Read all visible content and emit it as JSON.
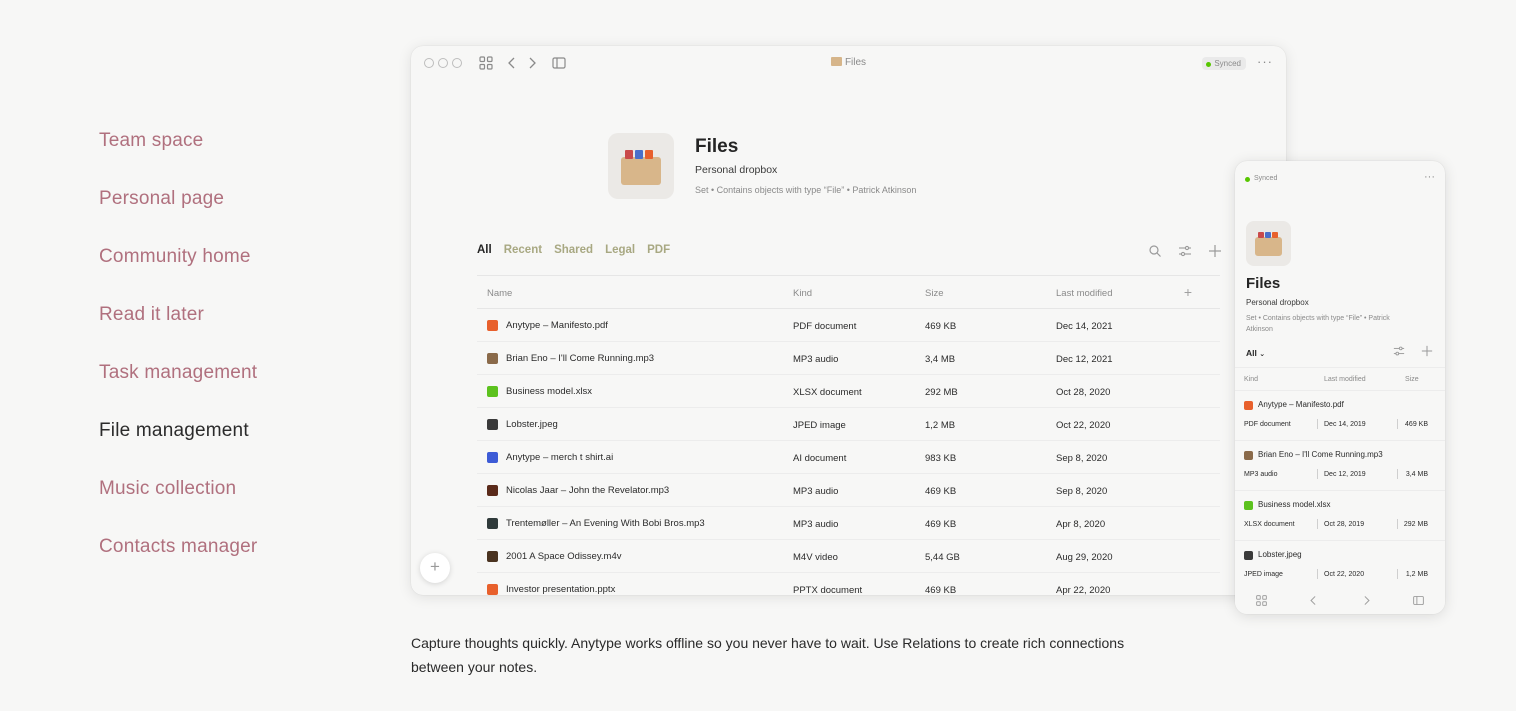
{
  "side_menu": {
    "items": [
      {
        "label": "Team space"
      },
      {
        "label": "Personal page"
      },
      {
        "label": "Community home"
      },
      {
        "label": "Read it later"
      },
      {
        "label": "Task management"
      },
      {
        "label": "File management",
        "active": true
      },
      {
        "label": "Music collection"
      },
      {
        "label": "Contacts manager"
      }
    ]
  },
  "desktop": {
    "window_title": "Files",
    "sync_status": "Synced",
    "set": {
      "title": "Files",
      "description": "Personal dropbox",
      "meta": "Set  •  Contains objects with type “File”  •  Patrick Atkinson"
    },
    "views": [
      "All",
      "Recent",
      "Shared",
      "Legal",
      "PDF"
    ],
    "columns": [
      "Name",
      "Kind",
      "Size",
      "Last modified"
    ],
    "rows": [
      {
        "name": "Anytype – Manifesto.pdf",
        "kind": "PDF document",
        "size": "469 KB",
        "modified": "Dec 14, 2021",
        "icon_color": "#e8602c"
      },
      {
        "name": "Brian Eno – I'll Come Running.mp3",
        "kind": "MP3 audio",
        "size": "3,4 MB",
        "modified": "Dec 12, 2021",
        "icon_color": "#8a6a4a"
      },
      {
        "name": "Business model.xlsx",
        "kind": "XLSX document",
        "size": "292 MB",
        "modified": "Oct 28, 2020",
        "icon_color": "#5cc21e"
      },
      {
        "name": "Lobster.jpeg",
        "kind": "JPED image",
        "size": "1,2 MB",
        "modified": "Oct 22, 2020",
        "icon_color": "#3a3a3a"
      },
      {
        "name": "Anytype – merch t shirt.ai",
        "kind": "AI document",
        "size": "983 KB",
        "modified": "Sep 8, 2020",
        "icon_color": "#3d5bd6"
      },
      {
        "name": "Nicolas Jaar – John the Revelator.mp3",
        "kind": "MP3 audio",
        "size": "469 KB",
        "modified": "Sep 8, 2020",
        "icon_color": "#5a2a1a"
      },
      {
        "name": "Trentemøller – An Evening With Bobi Bros.mp3",
        "kind": "MP3 audio",
        "size": "469 KB",
        "modified": "Apr 8, 2020",
        "icon_color": "#2f3a3a"
      },
      {
        "name": "2001 A Space Odissey.m4v",
        "kind": "M4V video",
        "size": "5,44 GB",
        "modified": "Aug 29, 2020",
        "icon_color": "#4a3320"
      },
      {
        "name": "Investor presentation.pptx",
        "kind": "PPTX document",
        "size": "469 KB",
        "modified": "Apr 22, 2020",
        "icon_color": "#e8602c"
      }
    ]
  },
  "mobile": {
    "sync_status": "Synced",
    "set": {
      "title": "Files",
      "description": "Personal dropbox",
      "meta": "Set  •  Contains objects with type “File”  •  Patrick Atkinson"
    },
    "view": "All",
    "columns": [
      "Kind",
      "Last modified",
      "Size"
    ],
    "rows": [
      {
        "name": "Anytype – Manifesto.pdf",
        "kind": "PDF document",
        "modified": "Dec 14, 2019",
        "size": "469 KB",
        "icon_color": "#e8602c"
      },
      {
        "name": "Brian Eno – I'll Come Running.mp3",
        "kind": "MP3 audio",
        "modified": "Dec 12, 2019",
        "size": "3,4 MB",
        "icon_color": "#8a6a4a"
      },
      {
        "name": "Business model.xlsx",
        "kind": "XLSX document",
        "modified": "Oct 28, 2019",
        "size": "292 MB",
        "icon_color": "#5cc21e"
      },
      {
        "name": "Lobster.jpeg",
        "kind": "JPED image",
        "modified": "Oct 22, 2020",
        "size": "1,2 MB",
        "icon_color": "#3a3a3a"
      }
    ]
  },
  "caption": "Capture thoughts quickly. Anytype works offline so you never have to wait. Use Relations to create rich connections between your notes."
}
